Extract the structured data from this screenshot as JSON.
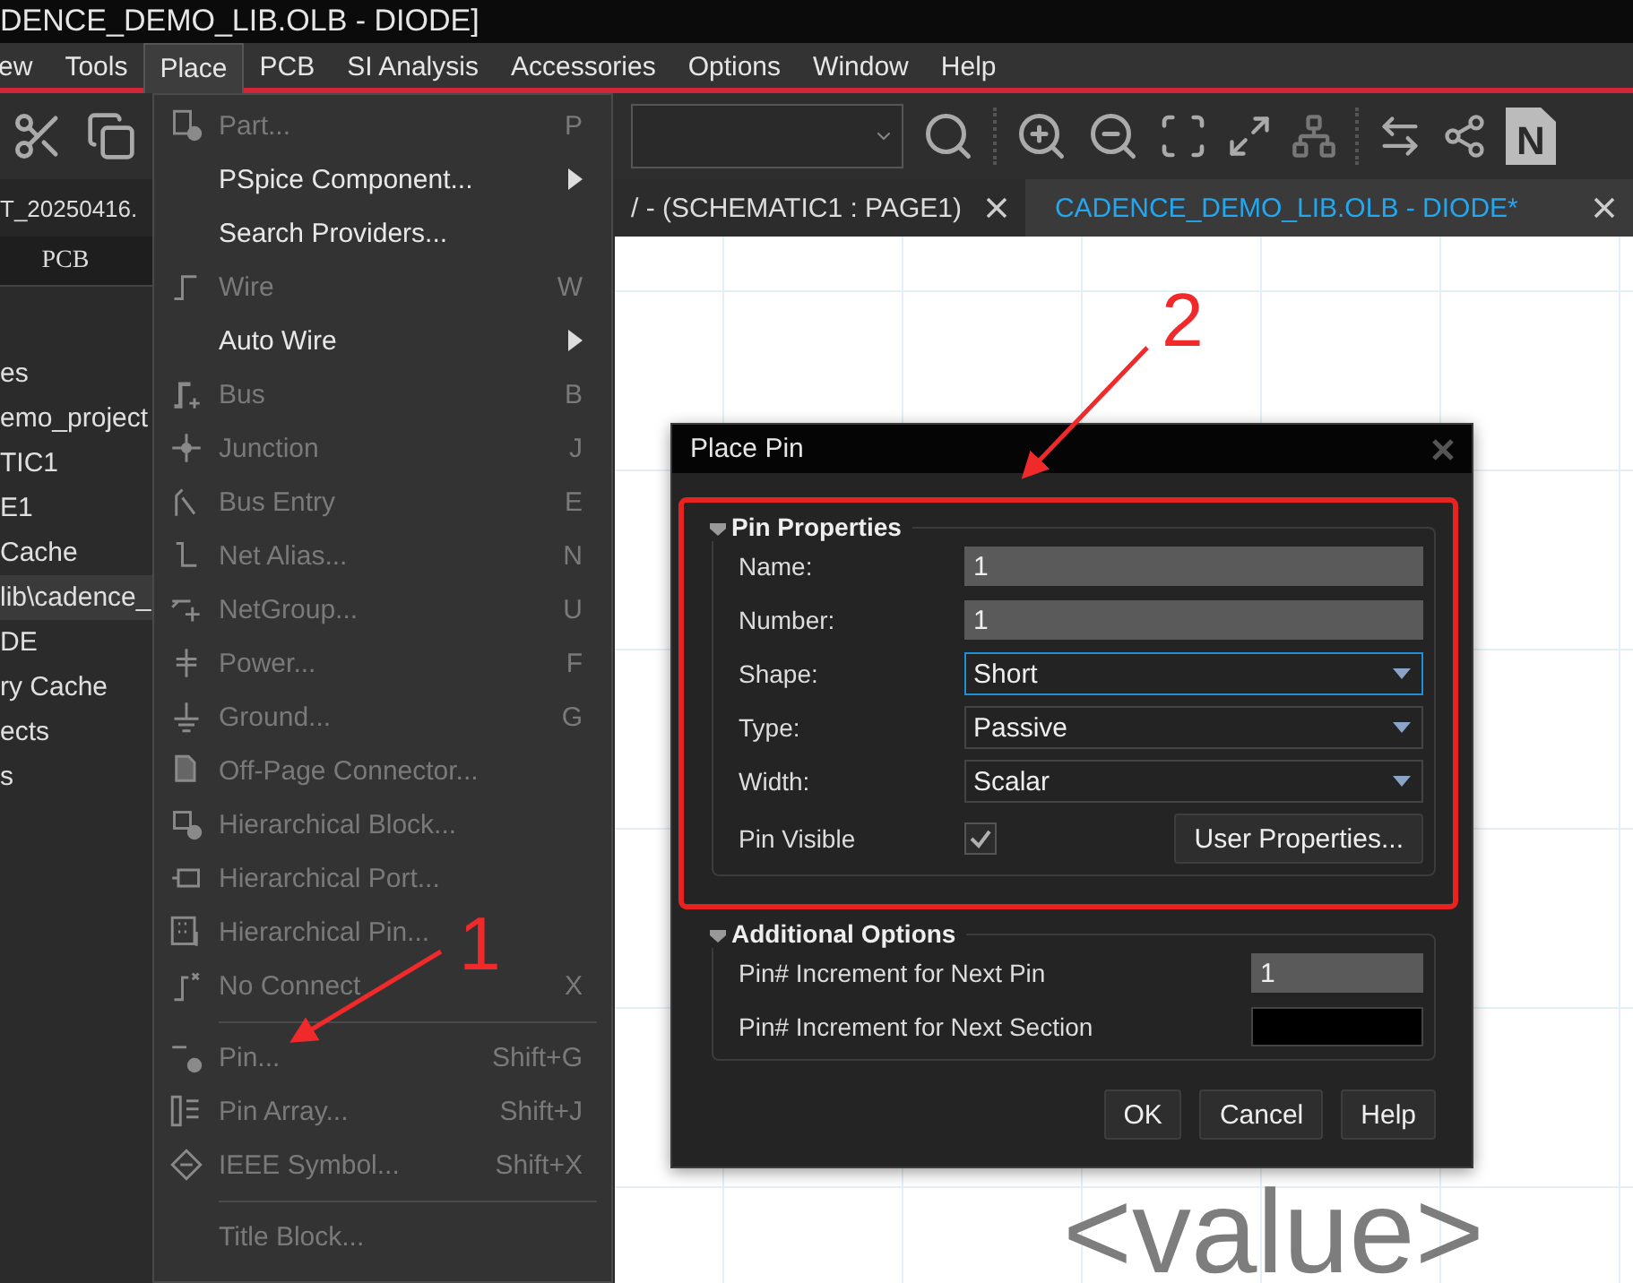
{
  "window": {
    "title": "DENCE_DEMO_LIB.OLB - DIODE]"
  },
  "menu_bar": [
    {
      "label": "ew",
      "selected": false
    },
    {
      "label": "Tools",
      "selected": false
    },
    {
      "label": "Place",
      "selected": true
    },
    {
      "label": "PCB",
      "selected": false
    },
    {
      "label": "SI Analysis",
      "selected": false
    },
    {
      "label": "Accessories",
      "selected": false
    },
    {
      "label": "Options",
      "selected": false
    },
    {
      "label": "Window",
      "selected": false
    },
    {
      "label": "Help",
      "selected": false
    }
  ],
  "toolbar": {
    "notes_button": "N"
  },
  "project_tab": "T_20250416.",
  "document_tabs": [
    {
      "label": "/ - (SCHEMATIC1 : PAGE1)",
      "selected": false
    },
    {
      "label": "CADENCE_DEMO_LIB.OLB - DIODE*",
      "selected": true
    }
  ],
  "sidebar": {
    "header": "PCB",
    "items": [
      {
        "label": "es",
        "selected": false
      },
      {
        "label": "emo_project",
        "selected": false
      },
      {
        "label": "TIC1",
        "selected": false
      },
      {
        "label": "E1",
        "selected": false
      },
      {
        "label": "Cache",
        "selected": false
      },
      {
        "label": "lib\\cadence_",
        "selected": true
      },
      {
        "label": "DE",
        "selected": false
      },
      {
        "label": "ry Cache",
        "selected": false
      },
      {
        "label": "ects",
        "selected": false
      },
      {
        "label": "s",
        "selected": false
      }
    ]
  },
  "place_menu": {
    "items": [
      {
        "kind": "item",
        "label": "Part...",
        "shortcut": "P",
        "disabled": true
      },
      {
        "kind": "submenu",
        "label": "PSpice Component...",
        "disabled": false
      },
      {
        "kind": "item",
        "label": "Search Providers...",
        "disabled": false
      },
      {
        "kind": "item",
        "label": "Wire",
        "shortcut": "W",
        "disabled": true
      },
      {
        "kind": "submenu",
        "label": "Auto Wire",
        "disabled": false
      },
      {
        "kind": "item",
        "label": "Bus",
        "shortcut": "B",
        "disabled": true
      },
      {
        "kind": "item",
        "label": "Junction",
        "shortcut": "J",
        "disabled": true
      },
      {
        "kind": "item",
        "label": "Bus Entry",
        "shortcut": "E",
        "disabled": true
      },
      {
        "kind": "item",
        "label": "Net Alias...",
        "shortcut": "N",
        "disabled": true
      },
      {
        "kind": "item",
        "label": "NetGroup...",
        "shortcut": "U",
        "disabled": true
      },
      {
        "kind": "item",
        "label": "Power...",
        "shortcut": "F",
        "disabled": true
      },
      {
        "kind": "item",
        "label": "Ground...",
        "shortcut": "G",
        "disabled": true
      },
      {
        "kind": "item",
        "label": "Off-Page Connector...",
        "disabled": true
      },
      {
        "kind": "item",
        "label": "Hierarchical Block...",
        "disabled": true
      },
      {
        "kind": "item",
        "label": "Hierarchical Port...",
        "disabled": true
      },
      {
        "kind": "item",
        "label": "Hierarchical Pin...",
        "disabled": true
      },
      {
        "kind": "item",
        "label": "No Connect",
        "shortcut": "X",
        "disabled": true
      },
      {
        "kind": "separator"
      },
      {
        "kind": "item",
        "label": "Pin...",
        "shortcut": "Shift+G",
        "disabled": true
      },
      {
        "kind": "item",
        "label": "Pin Array...",
        "shortcut": "Shift+J",
        "disabled": true
      },
      {
        "kind": "item",
        "label": "IEEE Symbol...",
        "shortcut": "Shift+X",
        "disabled": true
      },
      {
        "kind": "separator"
      },
      {
        "kind": "item",
        "label": "Title Block...",
        "disabled": true
      }
    ]
  },
  "canvas": {
    "text": "<value>"
  },
  "dialog": {
    "title": "Place Pin",
    "groups": [
      {
        "title": "Pin Properties",
        "rows": [
          {
            "kind": "text",
            "label": "Name:",
            "value": "1"
          },
          {
            "kind": "select",
            "label": "Number:",
            "value": "1"
          },
          {
            "kind": "dropdown",
            "label": "Shape:",
            "value": "Short",
            "focused": true
          },
          {
            "kind": "dropdown",
            "label": "Type:",
            "value": "Passive",
            "focused": false
          },
          {
            "kind": "dropdown",
            "label": "Width:",
            "value": "Scalar",
            "focused": false
          },
          {
            "kind": "checkbox",
            "label": "Pin Visible",
            "checked": true,
            "button": "User Properties..."
          }
        ]
      },
      {
        "title": "Additional Options",
        "rows": [
          {
            "kind": "short_text",
            "label": "Pin# Increment for Next Pin",
            "value": "1"
          },
          {
            "kind": "short_empty",
            "label": "Pin# Increment for Next Section"
          }
        ]
      }
    ],
    "buttons": [
      "OK",
      "Cancel",
      "Help"
    ]
  },
  "annotations": [
    {
      "label": "2"
    },
    {
      "label": "1"
    }
  ]
}
